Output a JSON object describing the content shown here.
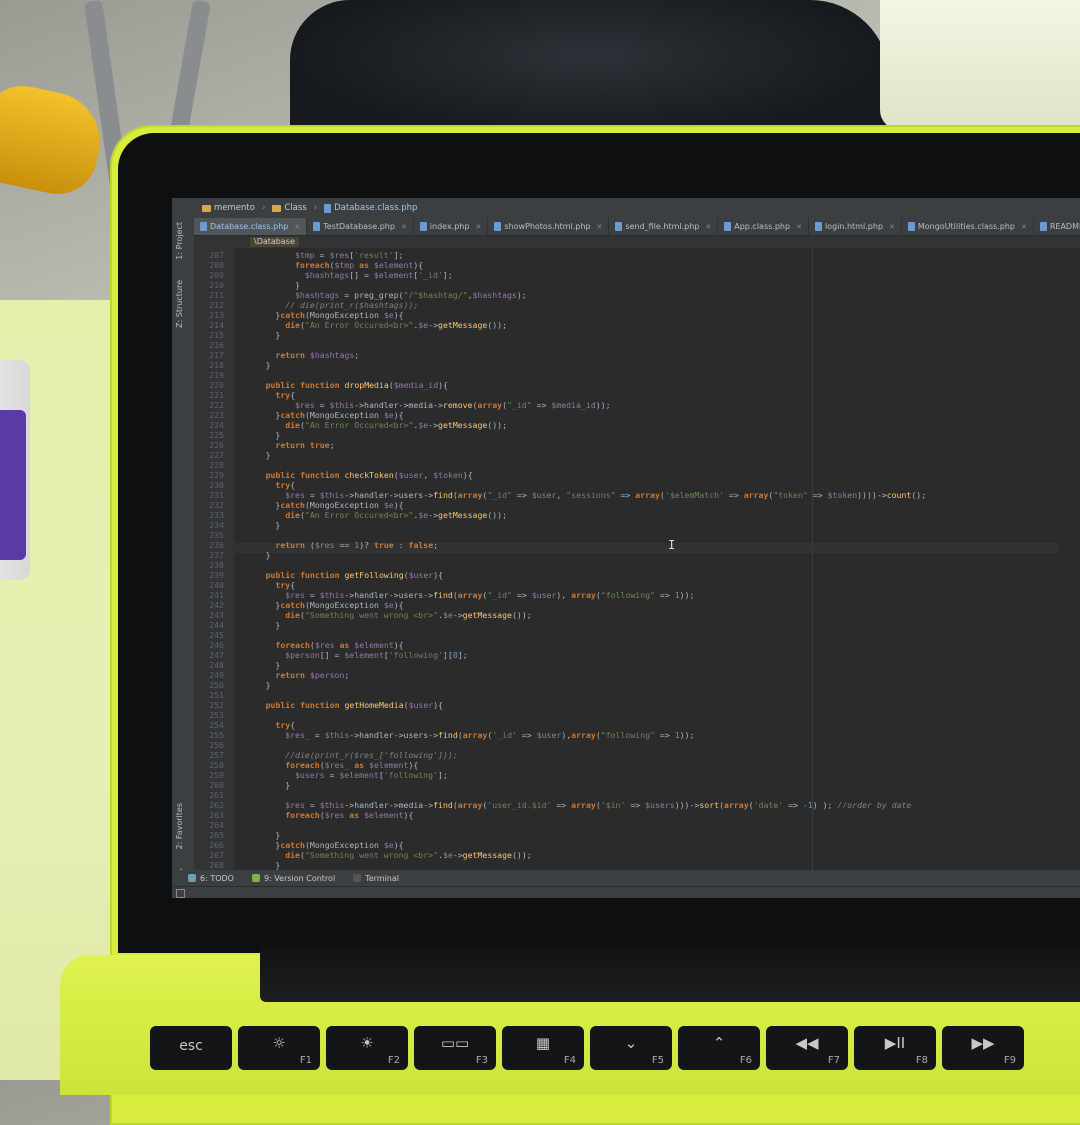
{
  "navbar": [
    {
      "label": "memento",
      "icon": "folder-icon"
    },
    {
      "label": "Class",
      "icon": "folder-icon"
    },
    {
      "label": "Database.class.php",
      "icon": "php-file-icon"
    }
  ],
  "tabs": [
    {
      "label": "Database.class.php",
      "active": true
    },
    {
      "label": "TestDatabase.php",
      "active": false
    },
    {
      "label": "index.php",
      "active": false
    },
    {
      "label": "showPhotos.html.php",
      "active": false
    },
    {
      "label": "send_file.html.php",
      "active": false
    },
    {
      "label": "App.class.php",
      "active": false
    },
    {
      "label": "login.html.php",
      "active": false
    },
    {
      "label": "MongoUtilities.class.php",
      "active": false
    },
    {
      "label": "README.md",
      "active": false
    }
  ],
  "sidebar": {
    "project": "1: Project",
    "structure": "Z: Structure",
    "favorites": "2: Favorites"
  },
  "breadcrumb": "\\Database",
  "code_lines": [
    {
      "n": "207",
      "i": 10,
      "h": "<span class='var'>$tmp</span> = <span class='var'>$res</span>[<span class='str'>'result'</span>];"
    },
    {
      "n": "208",
      "i": 10,
      "h": "<span class='kw'>foreach</span>(<span class='var'>$tmp</span> <span class='kw'>as</span> <span class='var'>$element</span>){"
    },
    {
      "n": "209",
      "i": 12,
      "h": "<span class='var'>$hashtags</span>[] = <span class='var'>$element</span>[<span class='str'>'_id'</span>];"
    },
    {
      "n": "210",
      "i": 10,
      "h": "}"
    },
    {
      "n": "211",
      "i": 10,
      "h": "<span class='var'>$hashtags</span> = preg_grep(<span class='str'>\"/^$hashtag/\"</span>,<span class='var'>$hashtags</span>);"
    },
    {
      "n": "212",
      "i": 8,
      "h": "<span class='com'>// die(print_r($hashtags));</span>"
    },
    {
      "n": "213",
      "i": 6,
      "h": "}<span class='kw'>catch</span>(MongoException <span class='var'>$e</span>){"
    },
    {
      "n": "214",
      "i": 8,
      "h": "<span class='kw'>die</span>(<span class='str'>\"An Error Occured&lt;br&gt;\"</span>.<span class='var'>$e</span>-&gt;<span class='fn'>getMessage</span>());"
    },
    {
      "n": "215",
      "i": 6,
      "h": "}"
    },
    {
      "n": "216",
      "i": 0,
      "h": ""
    },
    {
      "n": "217",
      "i": 6,
      "h": "<span class='kw'>return</span> <span class='var'>$hashtags</span>;"
    },
    {
      "n": "218",
      "i": 4,
      "h": "}"
    },
    {
      "n": "219",
      "i": 0,
      "h": ""
    },
    {
      "n": "220",
      "i": 4,
      "h": "<span class='kw'>public function</span> <span class='fn'>dropMedia</span>(<span class='var'>$media_id</span>){"
    },
    {
      "n": "221",
      "i": 6,
      "h": "<span class='kw'>try</span>{"
    },
    {
      "n": "222",
      "i": 10,
      "h": "<span class='var'>$res</span> = <span class='var'>$this</span>-&gt;handler-&gt;media-&gt;<span class='fn'>remove</span>(<span class='kw'>array</span>(<span class='str'>\"_id\"</span> =&gt; <span class='var'>$media_id</span>));"
    },
    {
      "n": "223",
      "i": 6,
      "h": "}<span class='kw'>catch</span>(MongoException <span class='var'>$e</span>){"
    },
    {
      "n": "224",
      "i": 8,
      "h": "<span class='kw'>die</span>(<span class='str'>\"An Error Occured&lt;br&gt;\"</span>.<span class='var'>$e</span>-&gt;<span class='fn'>getMessage</span>());"
    },
    {
      "n": "225",
      "i": 6,
      "h": "}"
    },
    {
      "n": "226",
      "i": 6,
      "h": "<span class='kw'>return true</span>;"
    },
    {
      "n": "227",
      "i": 4,
      "h": "}"
    },
    {
      "n": "228",
      "i": 0,
      "h": ""
    },
    {
      "n": "229",
      "i": 4,
      "h": "<span class='kw'>public function</span> <span class='fn'>checkToken</span>(<span class='var'>$user</span>, <span class='var'>$token</span>){"
    },
    {
      "n": "230",
      "i": 6,
      "h": "<span class='kw'>try</span>{"
    },
    {
      "n": "231",
      "i": 8,
      "h": "<span class='var'>$res</span> = <span class='var'>$this</span>-&gt;handler-&gt;users-&gt;<span class='fn'>find</span>(<span class='kw'>array</span>(<span class='str'>\"_id\"</span> =&gt; <span class='var'>$user</span>, <span class='str'>\"sessions\"</span> =&gt; <span class='kw'>array</span>(<span class='str'>'$elemMatch'</span> =&gt; <span class='kw'>array</span>(<span class='str'>\"token\"</span> =&gt; <span class='var'>$token</span>))))-&gt;<span class='fn'>count</span>();"
    },
    {
      "n": "232",
      "i": 6,
      "h": "}<span class='kw'>catch</span>(MongoException <span class='var'>$e</span>){"
    },
    {
      "n": "233",
      "i": 8,
      "h": "<span class='kw'>die</span>(<span class='str'>\"An Error Occured&lt;br&gt;\"</span>.<span class='var'>$e</span>-&gt;<span class='fn'>getMessage</span>());"
    },
    {
      "n": "234",
      "i": 6,
      "h": "}"
    },
    {
      "n": "235",
      "i": 0,
      "h": ""
    },
    {
      "n": "236",
      "i": 6,
      "h": "<span class='kw'>return</span> (<span class='var'>$res</span> == <span class='num'>1</span>)? <span class='kw'>true</span> : <span class='kw'>false</span>;"
    },
    {
      "n": "237",
      "i": 4,
      "h": "}"
    },
    {
      "n": "238",
      "i": 0,
      "h": ""
    },
    {
      "n": "239",
      "i": 4,
      "h": "<span class='kw'>public function</span> <span class='fn'>getFollowing</span>(<span class='var'>$user</span>){"
    },
    {
      "n": "240",
      "i": 6,
      "h": "<span class='kw'>try</span>{"
    },
    {
      "n": "241",
      "i": 8,
      "h": "<span class='var'>$res</span> = <span class='var'>$this</span>-&gt;handler-&gt;users-&gt;<span class='fn'>find</span>(<span class='kw'>array</span>(<span class='str'>\"_id\"</span> =&gt; <span class='var'>$user</span>), <span class='kw'>array</span>(<span class='str'>\"following\"</span> =&gt; <span class='num'>1</span>));"
    },
    {
      "n": "242",
      "i": 6,
      "h": "}<span class='kw'>catch</span>(MongoException <span class='var'>$e</span>){"
    },
    {
      "n": "243",
      "i": 8,
      "h": "<span class='kw'>die</span>(<span class='str'>\"Something went wrong &lt;br&gt;\"</span>.<span class='var'>$e</span>-&gt;<span class='fn'>getMessage</span>());"
    },
    {
      "n": "244",
      "i": 6,
      "h": "}"
    },
    {
      "n": "245",
      "i": 0,
      "h": ""
    },
    {
      "n": "246",
      "i": 6,
      "h": "<span class='kw'>foreach</span>(<span class='var'>$res</span> <span class='kw'>as</span> <span class='var'>$element</span>){"
    },
    {
      "n": "247",
      "i": 8,
      "h": "<span class='var'>$person</span>[] = <span class='var'>$element</span>[<span class='str'>'following'</span>][<span class='num'>0</span>];"
    },
    {
      "n": "248",
      "i": 6,
      "h": "}"
    },
    {
      "n": "249",
      "i": 6,
      "h": "<span class='kw'>return</span> <span class='var'>$person</span>;"
    },
    {
      "n": "250",
      "i": 4,
      "h": "}"
    },
    {
      "n": "251",
      "i": 0,
      "h": ""
    },
    {
      "n": "252",
      "i": 4,
      "h": "<span class='kw'>public function</span> <span class='fn'>getHomeMedia</span>(<span class='var'>$user</span>){"
    },
    {
      "n": "253",
      "i": 0,
      "h": ""
    },
    {
      "n": "254",
      "i": 6,
      "h": "<span class='kw'>try</span>{"
    },
    {
      "n": "255",
      "i": 8,
      "h": "<span class='var'>$res_</span> = <span class='var'>$this</span>-&gt;handler-&gt;users-&gt;<span class='fn'>find</span>(<span class='kw'>array</span>(<span class='str'>'_id'</span> =&gt; <span class='var'>$user</span>),<span class='kw'>array</span>(<span class='str'>\"following\"</span> =&gt; <span class='num'>1</span>));"
    },
    {
      "n": "256",
      "i": 0,
      "h": ""
    },
    {
      "n": "257",
      "i": 8,
      "h": "<span class='com'>//die(print_r($res_['following']));</span>"
    },
    {
      "n": "258",
      "i": 8,
      "h": "<span class='kw'>foreach</span>(<span class='var'>$res_</span> <span class='kw'>as</span> <span class='var'>$element</span>){"
    },
    {
      "n": "259",
      "i": 10,
      "h": "<span class='var'>$users</span> = <span class='var'>$element</span>[<span class='str'>'following'</span>];"
    },
    {
      "n": "260",
      "i": 8,
      "h": "}"
    },
    {
      "n": "261",
      "i": 0,
      "h": ""
    },
    {
      "n": "262",
      "i": 8,
      "h": "<span class='var'>$res</span> = <span class='var'>$this</span>-&gt;handler-&gt;media-&gt;<span class='fn'>find</span>(<span class='kw'>array</span>(<span class='str'>'user_id.$id'</span> =&gt; <span class='kw'>array</span>(<span class='str'>'$in'</span> =&gt; <span class='var'>$users</span>)))-&gt;<span class='fn'>sort</span>(<span class='kw'>array</span>(<span class='str'>'date'</span> =&gt; <span class='num'>-1</span>) ); <span class='com'>//order by date</span>"
    },
    {
      "n": "263",
      "i": 8,
      "h": "<span class='kw'>foreach</span>(<span class='var'>$res</span> <span class='kw'>as</span> <span class='var'>$element</span>){"
    },
    {
      "n": "264",
      "i": 0,
      "h": ""
    },
    {
      "n": "265",
      "i": 6,
      "h": "}"
    },
    {
      "n": "266",
      "i": 6,
      "h": "}<span class='kw'>catch</span>(MongoException <span class='var'>$e</span>){"
    },
    {
      "n": "267",
      "i": 8,
      "h": "<span class='kw'>die</span>(<span class='str'>\"Something went wrong &lt;br&gt;\"</span>.<span class='var'>$e</span>-&gt;<span class='fn'>getMessage</span>());"
    },
    {
      "n": "268",
      "i": 6,
      "h": "}"
    }
  ],
  "bottom_tabs": [
    {
      "label": "6: TODO",
      "icon": "todo-icon"
    },
    {
      "label": "9: Version Control",
      "icon": "version-control-icon"
    },
    {
      "label": "Terminal",
      "icon": "terminal-icon"
    }
  ],
  "keyboard": {
    "esc": "esc",
    "keys": [
      "F1",
      "F2",
      "F3",
      "F4",
      "F5",
      "F6",
      "F7",
      "F8",
      "F9"
    ]
  },
  "colors": {
    "editor_bg": "#2b2b2b",
    "keyword": "#cc7832",
    "function": "#ffc66d",
    "variable": "#9876aa",
    "string": "#6a8759",
    "laptop_shell": "#d7ec3c"
  }
}
